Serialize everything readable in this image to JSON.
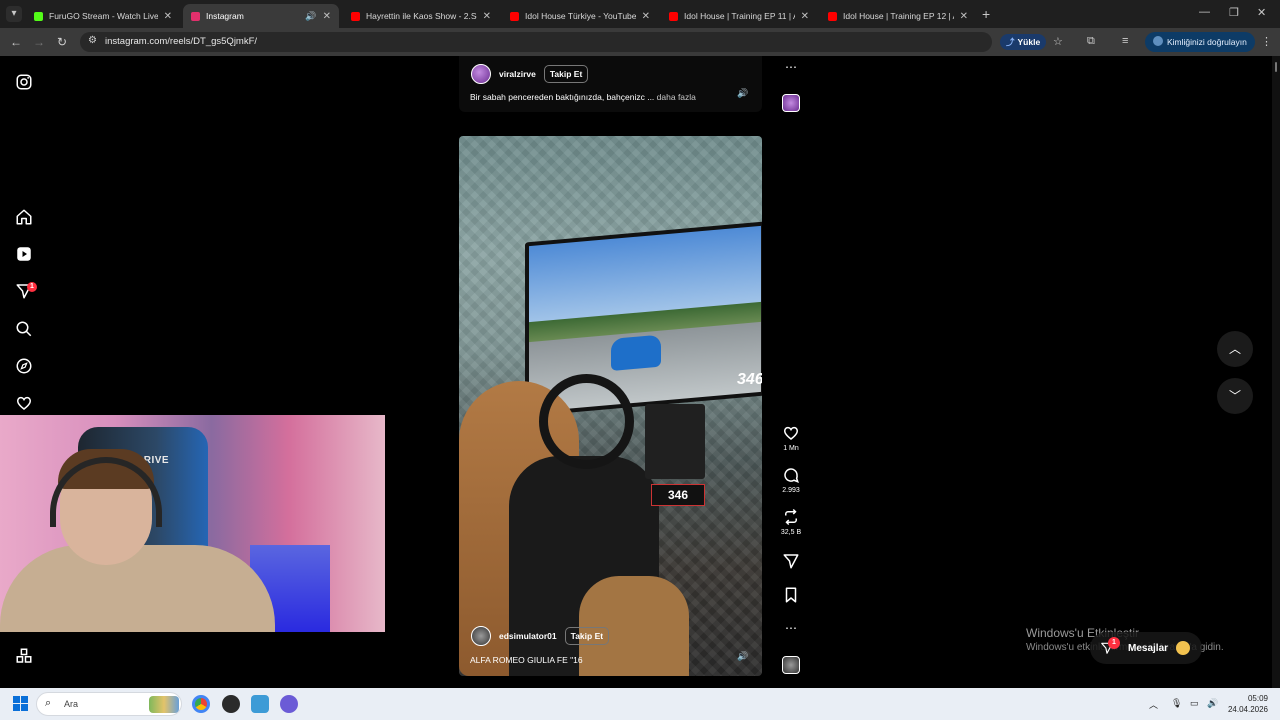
{
  "browser": {
    "tabs": [
      {
        "title": "FuruGO Stream - Watch Live on",
        "favicon_color": "#53fc18",
        "close": "✕"
      },
      {
        "title": "Instagram",
        "favicon_color": "#e1306c",
        "close": "✕",
        "active": true
      },
      {
        "title": "Hayrettin ile Kaos Show - 2.Sez",
        "favicon_color": "#ff0000",
        "close": "✕"
      },
      {
        "title": "Idol House Türkiye - YouTube",
        "favicon_color": "#ff0000",
        "close": "✕"
      },
      {
        "title": "Idol House | Training EP 11 | As",
        "favicon_color": "#ff0000",
        "close": "✕"
      },
      {
        "title": "Idol House | Training EP 12 | As",
        "favicon_color": "#ff0000",
        "close": "✕"
      }
    ],
    "url": "instagram.com/reels/DT_gs5QjmkF/",
    "upload_label": "Yükle",
    "verify_label": "Kimliğinizi doğrulayın"
  },
  "reel_prev": {
    "username": "viralzirve",
    "follow_label": "Takip Et",
    "caption": "Bir sabah pencereden baktığınızda, bahçenizc ...",
    "more_label": "daha fazla"
  },
  "reel": {
    "username": "edsimulator01",
    "follow_label": "Takip Et",
    "caption": "ALFA ROMEO GIULIA FE \"16",
    "hud_speed": "346",
    "dash_speed": "346",
    "likes": "1 Mn",
    "comments": "2.993",
    "reposts": "32,5 B"
  },
  "webcam": {
    "chair_text": "DRIVE"
  },
  "notifications": {
    "badge": "1",
    "messages_label": "Mesajlar",
    "messages_badge": "1"
  },
  "watermark": {
    "line1": "Windows'u Etkinleştir",
    "line2": "Windows'u etkinleştirmek için Ayarlar'a gidin."
  },
  "taskbar": {
    "search_placeholder": "Ara",
    "time": "05:09",
    "date": "24.04.2026"
  }
}
